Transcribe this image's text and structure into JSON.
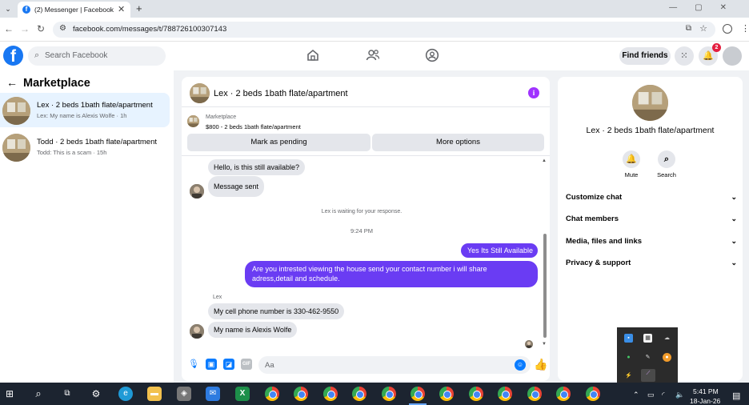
{
  "browser": {
    "tab_title": "(2) Messenger | Facebook",
    "url": "facebook.com/messages/t/788726100307143"
  },
  "header": {
    "search_placeholder": "Search Facebook",
    "find_friends": "Find friends",
    "notification_count": "2"
  },
  "sidebar": {
    "title": "Marketplace",
    "items": [
      {
        "title": "Lex · 2 beds 1bath flate/apartment",
        "subtitle": "Lex: My name is Alexis Wolfe · 1h",
        "active": true
      },
      {
        "title": "Todd · 2 beds 1bath flate/apartment",
        "subtitle": "Todd: This is a scam · 15h",
        "active": false
      }
    ]
  },
  "chat": {
    "title": "Lex · 2 beds 1bath flate/apartment",
    "listing_label": "Marketplace",
    "listing_price": "$800 - 2 beds 1bath flate/apartment",
    "mark_pending": "Mark as pending",
    "more_options": "More options",
    "messages": {
      "m1": "Hello, is this still available?",
      "m2": "Message sent",
      "waiting": "Lex is waiting for your response.",
      "time": "9:24 PM",
      "m3": "Yes Its Still Available",
      "m4_line1": "Are you intrested viewing the house send your contact number i will share",
      "m4_line2": "adress,detail and schedule.",
      "sender": "Lex",
      "m5": "My cell phone number is 330-462-9550",
      "m6": "My name is Alexis Wolfe"
    },
    "composer_placeholder": "Aa"
  },
  "info_panel": {
    "title": "Lex · 2 beds 1bath flate/apartment",
    "mute": "Mute",
    "search": "Search",
    "rows": [
      "Customize chat",
      "Chat members",
      "Media, files and links",
      "Privacy & support"
    ]
  },
  "taskbar": {
    "time": "5:41 PM",
    "date": "18-Jan-26"
  },
  "colors": {
    "fb_blue": "#1877f2",
    "outgoing_bubble": "#6a3cf3",
    "active_conversation": "#e7f3ff",
    "info_icon": "#a033ff"
  }
}
